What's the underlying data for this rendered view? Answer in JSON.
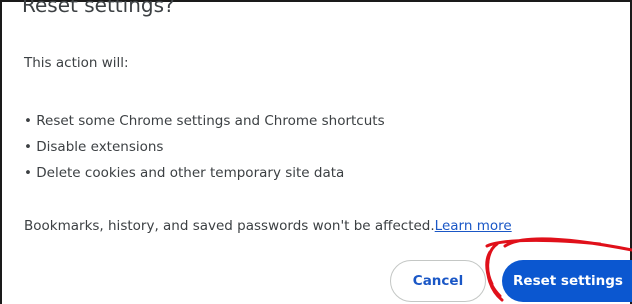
{
  "dialog": {
    "title": "Reset settings?",
    "intro": "This action will:",
    "bullets": [
      "• Reset some Chrome settings and Chrome shortcuts",
      "• Disable extensions",
      "• Delete cookies and other temporary site data"
    ],
    "footer_text": "Bookmarks, history, and saved passwords won't be affected.",
    "learn_more": "Learn more",
    "cancel_label": "Cancel",
    "reset_label": "Reset settings"
  },
  "colors": {
    "primary": "#0b57d0",
    "link": "#1a57c6",
    "annotation": "#e0101a"
  }
}
